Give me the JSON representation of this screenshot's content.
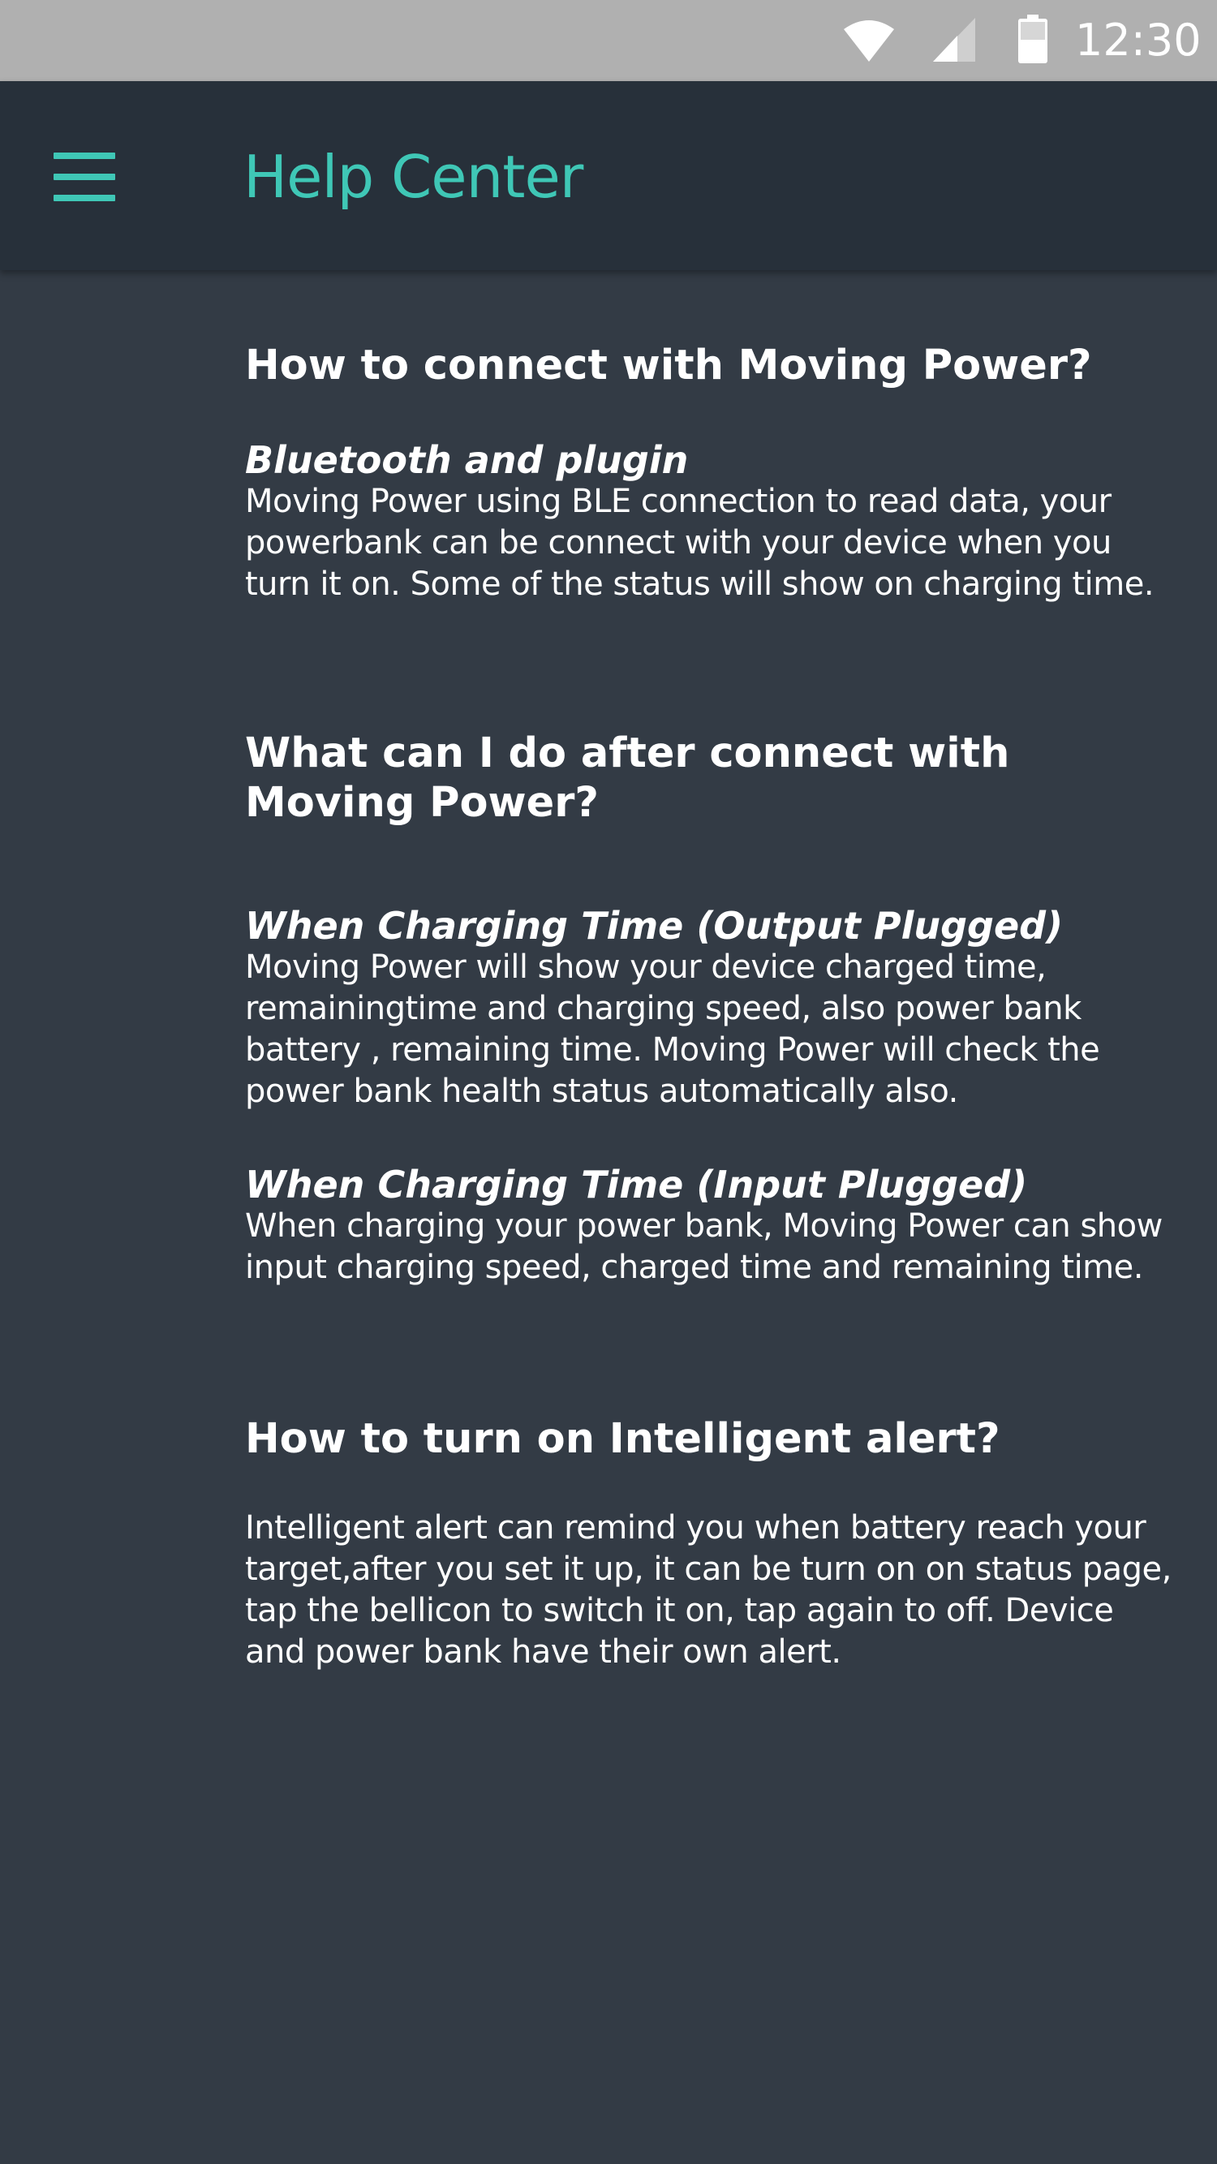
{
  "status_bar": {
    "time": "12:30",
    "icons": [
      "wifi-icon",
      "cell-signal-icon",
      "battery-icon"
    ]
  },
  "app_bar": {
    "title": "Help Center",
    "menu_icon": "hamburger-menu-icon",
    "accent_color": "#3fc7b6"
  },
  "sections": [
    {
      "title": "How to connect with Moving Power?",
      "items": [
        {
          "subtitle": "Bluetooth and plugin",
          "body": "Moving Power using BLE connection to read data, your powerbank can be connect with your device when you turn it on. Some of the status will show on charging time."
        }
      ]
    },
    {
      "title": "What can I do after connect with Moving Power?",
      "items": [
        {
          "subtitle": "When Charging Time (Output Plugged)",
          "body": "Moving Power will show your device charged time, remainingtime and charging speed, also power bank battery , remaining time. Moving Power will check the power bank health status automatically also."
        },
        {
          "subtitle": "When Charging Time (Input Plugged)",
          "body": "When charging your power bank, Moving Power can show input charging speed, charged time and remaining time."
        }
      ]
    },
    {
      "title": "How to turn on Intelligent alert?",
      "items": [
        {
          "subtitle": "",
          "body": "Intelligent alert can remind you when battery reach your target,after you set it up, it can be turn on on status page, tap the bellicon to switch it on, tap again to off. Device and power bank have their own alert."
        }
      ]
    }
  ],
  "colors": {
    "background": "#333b45",
    "app_bar": "#27303a",
    "status_bar": "#b0b0b0",
    "text": "#ffffff"
  }
}
